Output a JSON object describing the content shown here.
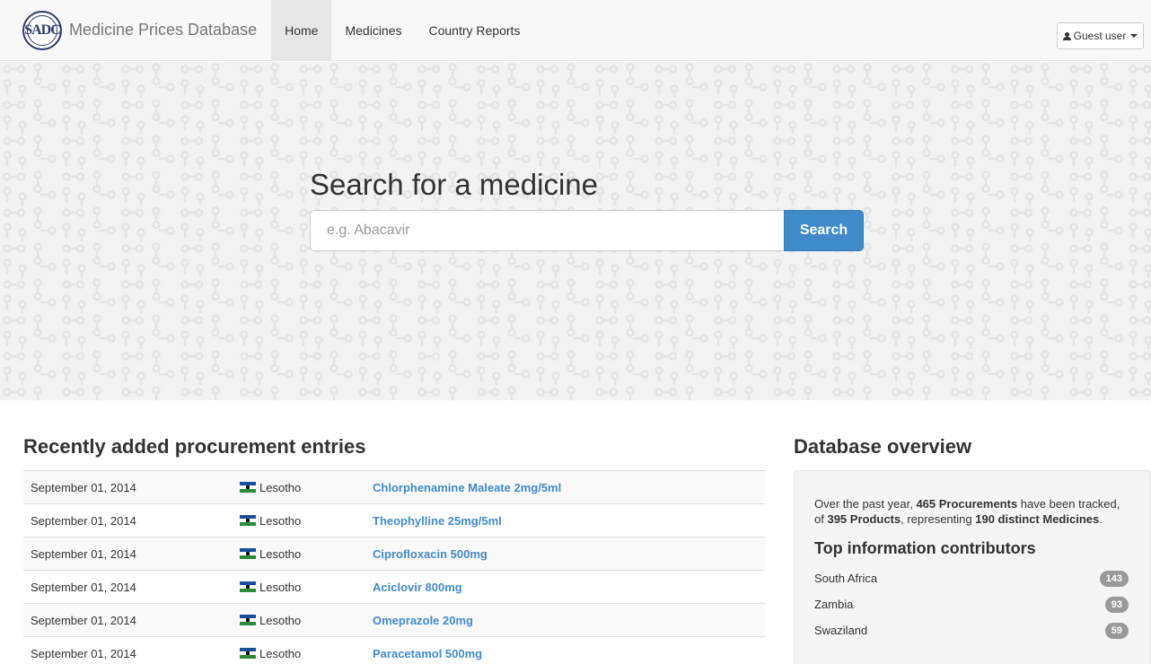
{
  "brand": {
    "logo_text": "SADC",
    "name": "Medicine Prices Database"
  },
  "nav": {
    "items": [
      {
        "label": "Home",
        "active": true
      },
      {
        "label": "Medicines",
        "active": false
      },
      {
        "label": "Country Reports",
        "active": false
      }
    ],
    "user_menu": "Guest user"
  },
  "hero": {
    "title": "Search for a medicine",
    "search_placeholder": "e.g. Abacavir",
    "search_button": "Search"
  },
  "recent": {
    "title": "Recently added procurement entries",
    "rows": [
      {
        "date": "September 01, 2014",
        "country": "Lesotho",
        "medicine": "Chlorphenamine Maleate 2mg/5ml"
      },
      {
        "date": "September 01, 2014",
        "country": "Lesotho",
        "medicine": "Theophylline 25mg/5ml"
      },
      {
        "date": "September 01, 2014",
        "country": "Lesotho",
        "medicine": "Ciprofloxacin 500mg"
      },
      {
        "date": "September 01, 2014",
        "country": "Lesotho",
        "medicine": "Aciclovir 800mg"
      },
      {
        "date": "September 01, 2014",
        "country": "Lesotho",
        "medicine": "Omeprazole 20mg"
      },
      {
        "date": "September 01, 2014",
        "country": "Lesotho",
        "medicine": "Paracetamol 500mg"
      }
    ]
  },
  "overview": {
    "title": "Database overview",
    "text_1": "Over the past year, ",
    "procurements": "465 Procurements",
    "text_2": " have been tracked, of ",
    "products": "395 Products",
    "text_3": ", representing ",
    "medicines": "190 distinct Medicines",
    "text_4": ".",
    "contributors_title": "Top information contributors",
    "contributors": [
      {
        "country": "South Africa",
        "count": "143"
      },
      {
        "country": "Zambia",
        "count": "93"
      },
      {
        "country": "Swaziland",
        "count": "59"
      }
    ]
  },
  "colors": {
    "primary": "#428bca",
    "navbar_bg": "#f8f8f8",
    "badge": "#999999",
    "well_bg": "#f5f5f5"
  }
}
